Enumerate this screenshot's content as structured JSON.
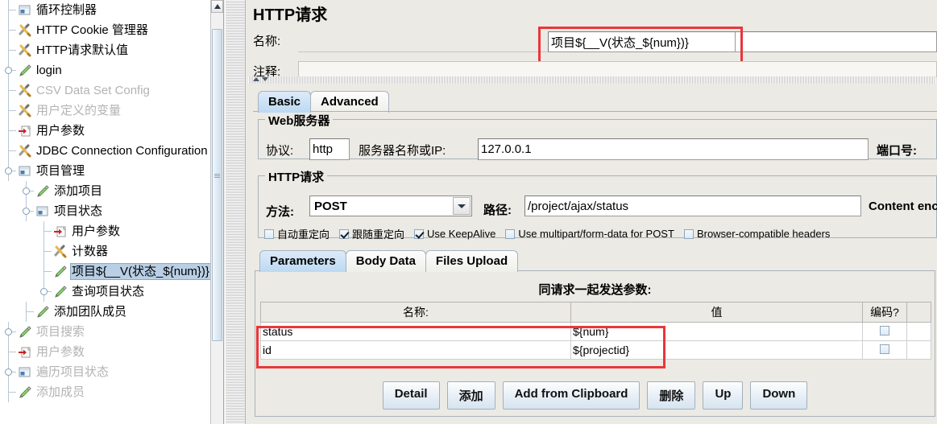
{
  "tree": {
    "items": [
      {
        "label": "循环控制器",
        "icon": "controller-icon",
        "indent": 22,
        "dim": false,
        "selected": false,
        "handle": false
      },
      {
        "label": "HTTP Cookie 管理器",
        "icon": "config-tool-icon",
        "indent": 22,
        "dim": false,
        "selected": false,
        "handle": false
      },
      {
        "label": "HTTP请求默认值",
        "icon": "config-tool-icon",
        "indent": 22,
        "dim": false,
        "selected": false,
        "handle": false
      },
      {
        "label": "login",
        "icon": "sampler-pen-icon",
        "indent": 22,
        "dim": false,
        "selected": false,
        "handle": true
      },
      {
        "label": "CSV Data Set Config",
        "icon": "config-tool-icon",
        "indent": 22,
        "dim": true,
        "selected": false,
        "handle": false
      },
      {
        "label": "用户定义的变量",
        "icon": "config-tool-icon",
        "indent": 22,
        "dim": true,
        "selected": false,
        "handle": false
      },
      {
        "label": "用户参数",
        "icon": "user-params-icon",
        "indent": 22,
        "dim": false,
        "selected": false,
        "handle": false
      },
      {
        "label": "JDBC Connection Configuration",
        "icon": "config-tool-icon",
        "indent": 22,
        "dim": false,
        "selected": false,
        "handle": false
      },
      {
        "label": "项目管理",
        "icon": "controller-icon",
        "indent": 22,
        "dim": false,
        "selected": false,
        "handle": true
      },
      {
        "label": "添加项目",
        "icon": "sampler-pen-icon",
        "indent": 44,
        "dim": false,
        "selected": false,
        "handle": true
      },
      {
        "label": "项目状态",
        "icon": "controller-icon",
        "indent": 44,
        "dim": false,
        "selected": false,
        "handle": true
      },
      {
        "label": "用户参数",
        "icon": "user-params-icon",
        "indent": 66,
        "dim": false,
        "selected": false,
        "handle": false
      },
      {
        "label": "计数器",
        "icon": "config-tool-icon",
        "indent": 66,
        "dim": false,
        "selected": false,
        "handle": false
      },
      {
        "label": "项目${__V(状态_${num})}",
        "icon": "sampler-pen-icon",
        "indent": 66,
        "dim": false,
        "selected": true,
        "handle": false
      },
      {
        "label": "查询项目状态",
        "icon": "sampler-pen-icon",
        "indent": 66,
        "dim": false,
        "selected": false,
        "handle": true
      },
      {
        "label": "添加团队成员",
        "icon": "sampler-pen-icon",
        "indent": 44,
        "dim": false,
        "selected": false,
        "handle": false
      },
      {
        "label": "项目搜索",
        "icon": "sampler-pen-icon",
        "indent": 22,
        "dim": true,
        "selected": false,
        "handle": true
      },
      {
        "label": "用户参数",
        "icon": "user-params-icon",
        "indent": 22,
        "dim": true,
        "selected": false,
        "handle": false
      },
      {
        "label": "遍历项目状态",
        "icon": "controller-icon",
        "indent": 22,
        "dim": true,
        "selected": false,
        "handle": true
      },
      {
        "label": "添加成员",
        "icon": "sampler-pen-icon",
        "indent": 22,
        "dim": true,
        "selected": false,
        "handle": false
      }
    ]
  },
  "panel": {
    "title": "HTTP请求",
    "name_label": "名称:",
    "name_value": "项目${__V(状态_${num})}",
    "comment_label": "注释:",
    "comment_value": ""
  },
  "top_tabs": [
    {
      "label": "Basic",
      "active": true
    },
    {
      "label": "Advanced",
      "active": false
    }
  ],
  "web_server": {
    "group_title": "Web服务器",
    "protocol_label": "协议:",
    "protocol_value": "http",
    "server_label": "服务器名称或IP:",
    "server_value": "127.0.0.1",
    "port_label": "端口号:",
    "port_value": ""
  },
  "http_request": {
    "group_title": "HTTP请求",
    "method_label": "方法:",
    "method_value": "POST",
    "path_label": "路径:",
    "path_value": "/project/ajax/status",
    "content_encoding_label": "Content enco",
    "checkboxes": [
      {
        "label": "自动重定向",
        "checked": false
      },
      {
        "label": "跟随重定向",
        "checked": true
      },
      {
        "label": "Use KeepAlive",
        "checked": true
      },
      {
        "label": "Use multipart/form-data for POST",
        "checked": false
      },
      {
        "label": "Browser-compatible headers",
        "checked": false
      }
    ]
  },
  "param_tabs": [
    {
      "label": "Parameters",
      "active": true
    },
    {
      "label": "Body Data",
      "active": false
    },
    {
      "label": "Files Upload",
      "active": false
    }
  ],
  "params": {
    "caption": "同请求一起发送参数:",
    "columns": [
      "名称:",
      "值",
      "编码?",
      ""
    ],
    "rows": [
      {
        "name": "status",
        "value": "${num}",
        "encode": false
      },
      {
        "name": "id",
        "value": "${projectid}",
        "encode": false
      }
    ]
  },
  "buttons": [
    {
      "label": "Detail"
    },
    {
      "label": "添加"
    },
    {
      "label": "Add from Clipboard"
    },
    {
      "label": "删除"
    },
    {
      "label": "Up"
    },
    {
      "label": "Down"
    }
  ],
  "colors": {
    "highlight": "#e8373b",
    "tab_active": "#bcd9f2",
    "selection": "#b8cfe5",
    "panel_bg": "#eceae4"
  }
}
